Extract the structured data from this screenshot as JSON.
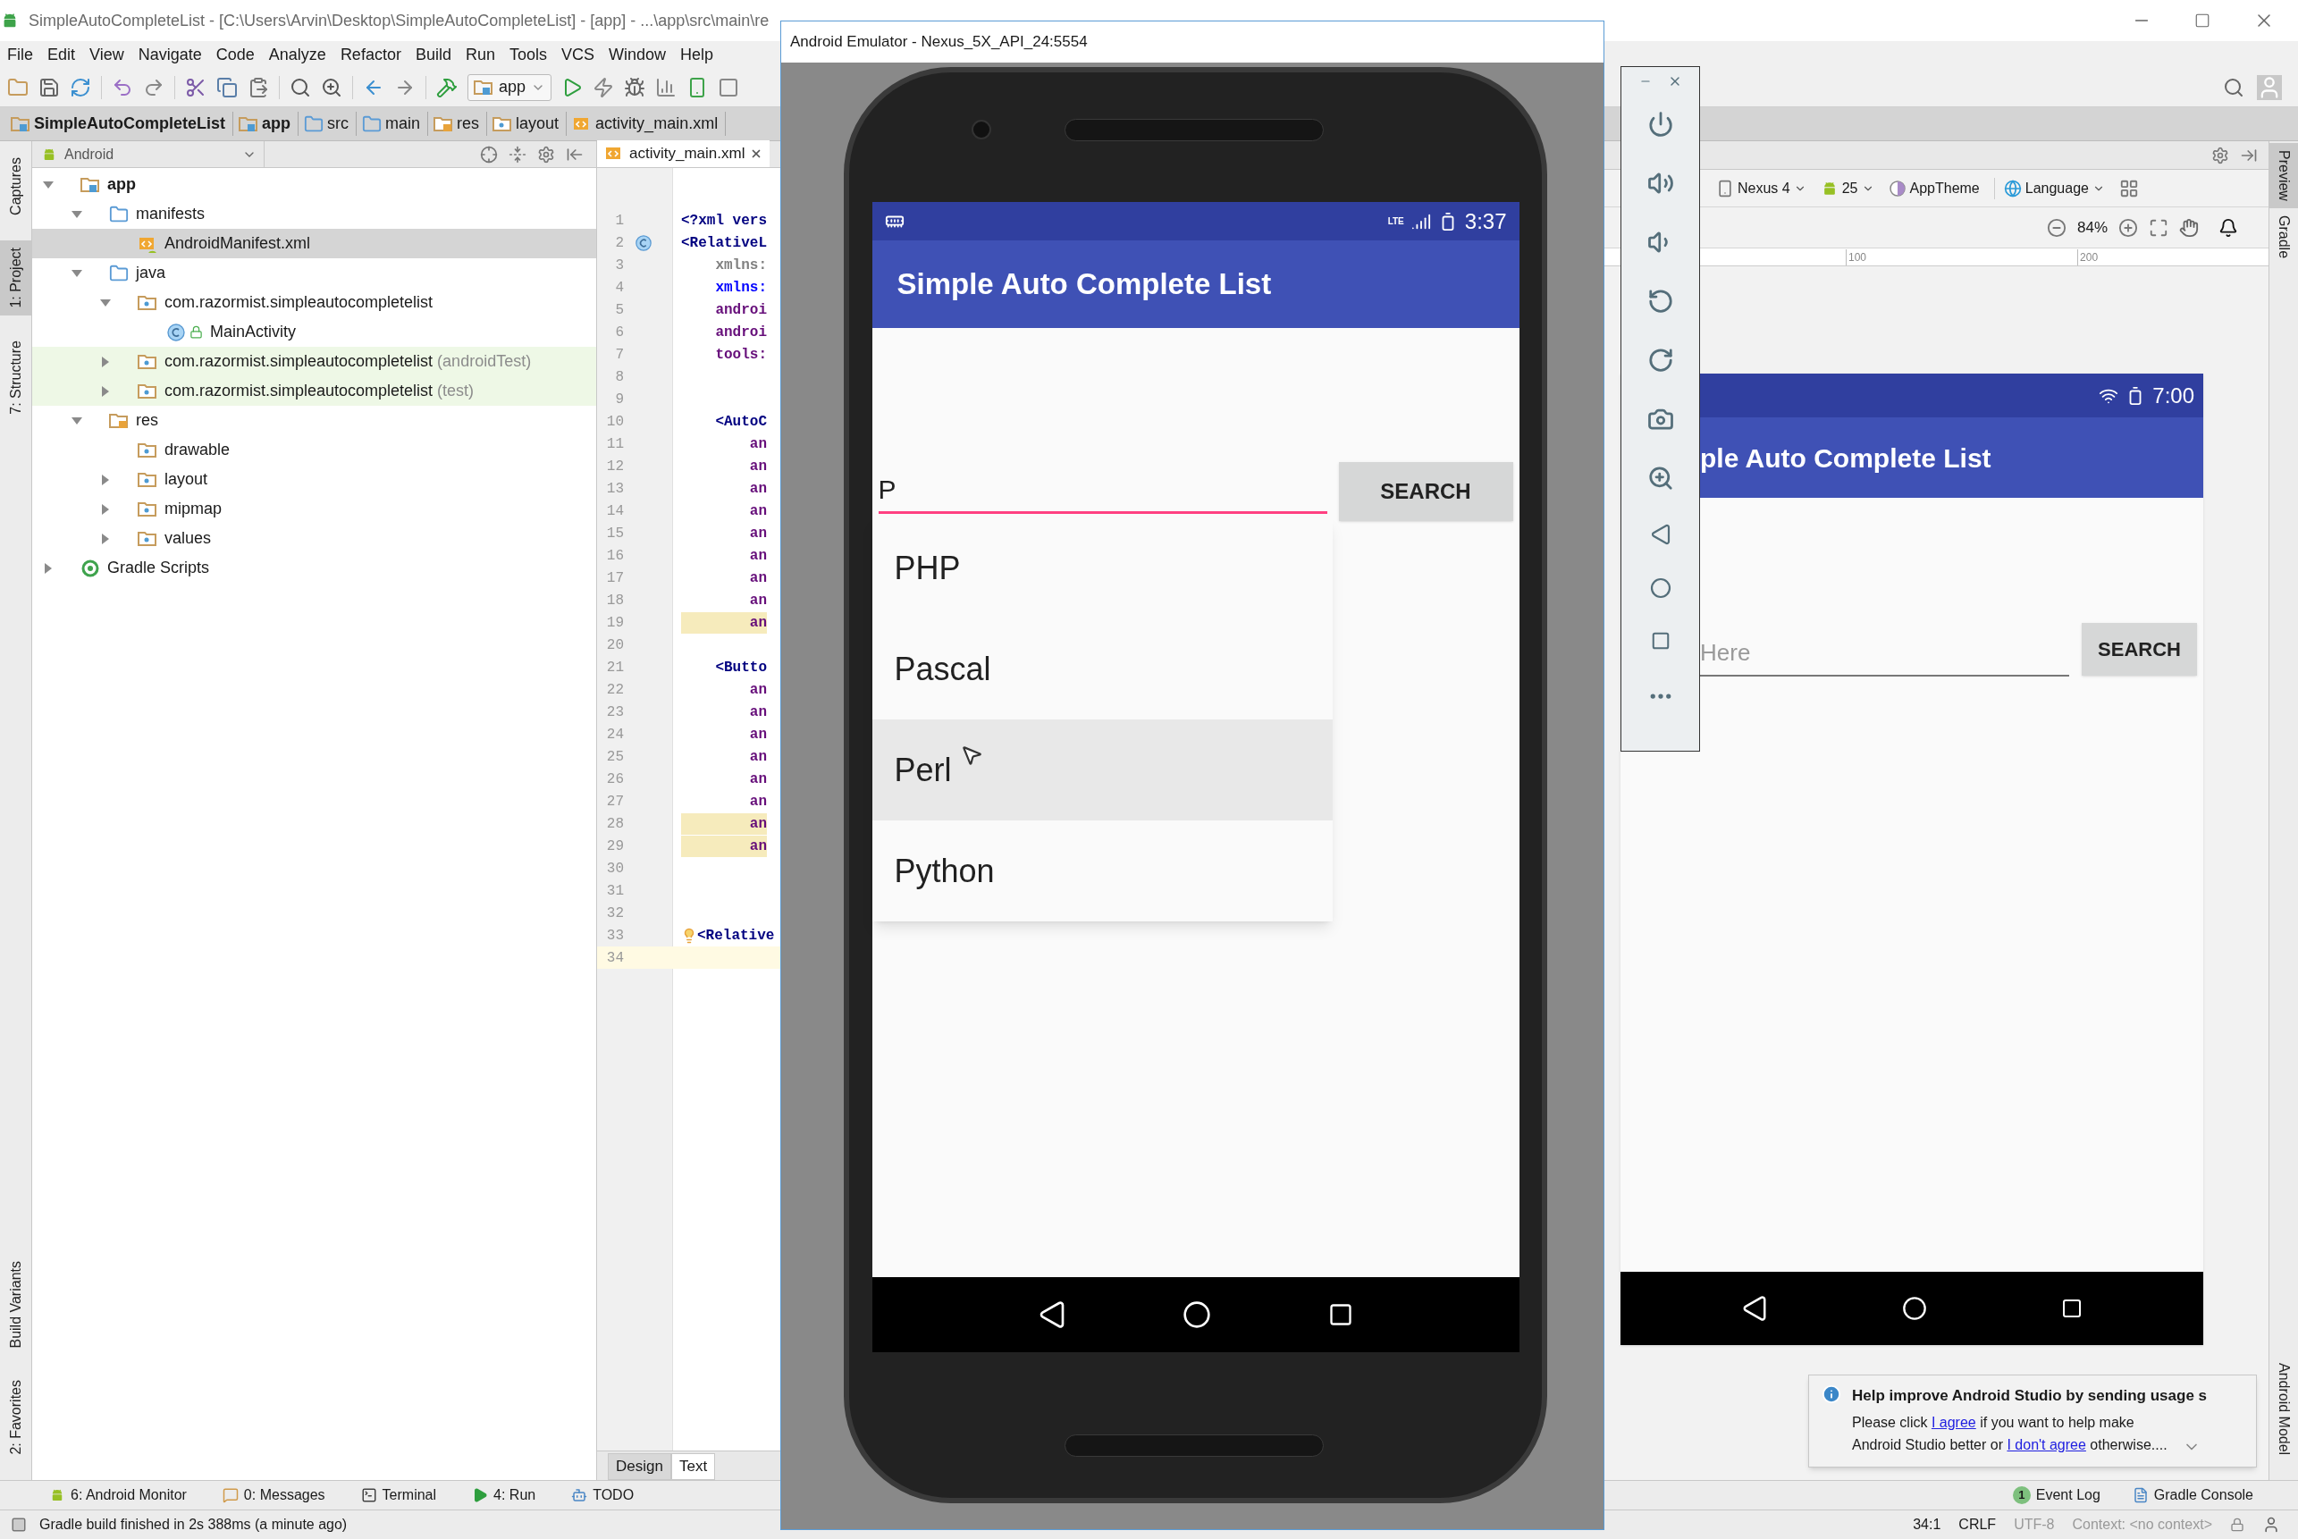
{
  "window": {
    "title": "SimpleAutoCompleteList - [C:\\Users\\Arvin\\Desktop\\SimpleAutoCompleteList] - [app] - ...\\app\\src\\main\\re"
  },
  "menu": [
    "File",
    "Edit",
    "View",
    "Navigate",
    "Code",
    "Analyze",
    "Refactor",
    "Build",
    "Run",
    "Tools",
    "VCS",
    "Window",
    "Help"
  ],
  "toolbar": {
    "run_config": "app"
  },
  "breadcrumb": [
    {
      "label": "SimpleAutoCompleteList",
      "kind": "project"
    },
    {
      "label": "app",
      "kind": "module"
    },
    {
      "label": "src",
      "kind": "folder"
    },
    {
      "label": "main",
      "kind": "folder"
    },
    {
      "label": "res",
      "kind": "res"
    },
    {
      "label": "layout",
      "kind": "layout"
    },
    {
      "label": "activity_main.xml",
      "kind": "xml"
    }
  ],
  "left_strip": [
    {
      "label": "Captures",
      "selected": false
    },
    {
      "label": "1: Project",
      "selected": true
    },
    {
      "label": "7: Structure",
      "selected": false
    },
    {
      "label": "Build Variants",
      "selected": false
    },
    {
      "label": "2: Favorites",
      "selected": false
    }
  ],
  "project": {
    "view": "Android",
    "tree": [
      {
        "label": "app",
        "kind": "module",
        "selected": false,
        "test": false,
        "expanded": true,
        "children": [
          {
            "label": "manifests",
            "kind": "folder",
            "selected": false,
            "test": false,
            "expanded": true,
            "children": [
              {
                "label": "AndroidManifest.xml",
                "kind": "manifest",
                "selected": true,
                "test": false
              }
            ]
          },
          {
            "label": "java",
            "kind": "folder",
            "selected": false,
            "test": false,
            "expanded": true,
            "children": [
              {
                "label": "com.razormist.simpleautocompletelist",
                "kind": "package",
                "selected": false,
                "test": false,
                "expanded": true,
                "children": [
                  {
                    "label": "MainActivity",
                    "kind": "class",
                    "selected": false,
                    "test": false
                  }
                ]
              },
              {
                "label": "com.razormist.simpleautocompletelist",
                "note": "(androidTest)",
                "kind": "package",
                "selected": false,
                "test": true,
                "expanded": false
              },
              {
                "label": "com.razormist.simpleautocompletelist",
                "note": "(test)",
                "kind": "package",
                "selected": false,
                "test": true,
                "expanded": false
              }
            ]
          },
          {
            "label": "res",
            "kind": "res",
            "selected": false,
            "test": false,
            "expanded": true,
            "children": [
              {
                "label": "drawable",
                "kind": "package",
                "selected": false,
                "test": false
              },
              {
                "label": "layout",
                "kind": "package",
                "selected": false,
                "test": false,
                "expanded": false
              },
              {
                "label": "mipmap",
                "kind": "package",
                "selected": false,
                "test": false,
                "expanded": false
              },
              {
                "label": "values",
                "kind": "package",
                "selected": false,
                "test": false,
                "expanded": false
              }
            ]
          }
        ]
      },
      {
        "label": "Gradle Scripts",
        "kind": "gradle",
        "selected": false,
        "test": false,
        "expanded": false
      }
    ]
  },
  "editor": {
    "tabs": [
      {
        "label": "activity_main.xml",
        "selected": true
      }
    ],
    "lines": [
      {
        "n": "1",
        "code": "<?xml vers",
        "kind": "decl",
        "warning": false,
        "current": false
      },
      {
        "n": "2",
        "code": "<RelativeL",
        "kind": "tag",
        "warning": false,
        "current": false,
        "gutter_icon": {
          "kind": "class"
        }
      },
      {
        "n": "3",
        "code": "    xmlns:",
        "kind": "ns_grey",
        "warning": false,
        "current": false
      },
      {
        "n": "4",
        "code": "    xmlns:",
        "kind": "ns",
        "warning": false,
        "current": false
      },
      {
        "n": "5",
        "code": "    androi",
        "kind": "attr",
        "warning": false,
        "current": false
      },
      {
        "n": "6",
        "code": "    androi",
        "kind": "attr",
        "warning": false,
        "current": false
      },
      {
        "n": "7",
        "code": "    tools:",
        "kind": "attr",
        "warning": false,
        "current": false
      },
      {
        "n": "8",
        "warning": false,
        "current": false
      },
      {
        "n": "9",
        "warning": false,
        "current": false
      },
      {
        "n": "10",
        "code": "    <AutoC",
        "kind": "tag",
        "warning": false,
        "current": false
      },
      {
        "n": "11",
        "code": "        an",
        "kind": "attr",
        "warning": false,
        "current": false
      },
      {
        "n": "12",
        "code": "        an",
        "kind": "attr",
        "warning": false,
        "current": false
      },
      {
        "n": "13",
        "code": "        an",
        "kind": "attr",
        "warning": false,
        "current": false
      },
      {
        "n": "14",
        "code": "        an",
        "kind": "attr",
        "warning": false,
        "current": false
      },
      {
        "n": "15",
        "code": "        an",
        "kind": "attr",
        "warning": false,
        "current": false
      },
      {
        "n": "16",
        "code": "        an",
        "kind": "attr",
        "warning": false,
        "current": false
      },
      {
        "n": "17",
        "code": "        an",
        "kind": "attr",
        "warning": false,
        "current": false
      },
      {
        "n": "18",
        "code": "        an",
        "kind": "attr",
        "warning": false,
        "current": false
      },
      {
        "n": "19",
        "code": "        an",
        "kind": "attr",
        "warning": true,
        "current": false
      },
      {
        "n": "20",
        "warning": false,
        "current": false
      },
      {
        "n": "21",
        "code": "    <Butto",
        "kind": "tag",
        "warning": false,
        "current": false
      },
      {
        "n": "22",
        "code": "        an",
        "kind": "attr",
        "warning": false,
        "current": false
      },
      {
        "n": "23",
        "code": "        an",
        "kind": "attr",
        "warning": false,
        "current": false
      },
      {
        "n": "24",
        "code": "        an",
        "kind": "attr",
        "warning": false,
        "current": false
      },
      {
        "n": "25",
        "code": "        an",
        "kind": "attr",
        "warning": false,
        "current": false
      },
      {
        "n": "26",
        "code": "        an",
        "kind": "attr",
        "warning": false,
        "current": false
      },
      {
        "n": "27",
        "code": "        an",
        "kind": "attr",
        "warning": false,
        "current": false
      },
      {
        "n": "28",
        "code": "        an",
        "kind": "attr",
        "warning": true,
        "current": false
      },
      {
        "n": "29",
        "code": "        an",
        "kind": "attr",
        "warning": true,
        "current": false
      },
      {
        "n": "30",
        "warning": false,
        "current": false
      },
      {
        "n": "31",
        "warning": false,
        "current": false
      },
      {
        "n": "32",
        "warning": false,
        "current": false
      },
      {
        "n": "33",
        "code": "<Relative",
        "kind": "tag",
        "warning": false,
        "current": false,
        "inline_icon": {
          "kind": "bulb"
        }
      },
      {
        "n": "34",
        "warning": false,
        "current": true
      }
    ],
    "mode_tabs": [
      {
        "label": "Design",
        "selected": false
      },
      {
        "label": "Text",
        "selected": true
      }
    ]
  },
  "emulator": {
    "title": "Android Emulator - Nexus_5X_API_24:5554",
    "network": "LTE",
    "time": "3:37",
    "app_title": "Simple Auto Complete List",
    "input_value": "P",
    "button": "SEARCH",
    "suggestions": [
      {
        "label": "PHP",
        "selected": false
      },
      {
        "label": "Pascal",
        "selected": false
      },
      {
        "label": "Perl",
        "selected": true
      },
      {
        "label": "Python",
        "selected": false
      }
    ],
    "controls": [
      {
        "kind": "power"
      },
      {
        "kind": "volume_up"
      },
      {
        "kind": "volume_down"
      },
      {
        "kind": "rotate_left"
      },
      {
        "kind": "rotate_right"
      },
      {
        "kind": "screenshot"
      },
      {
        "kind": "zoom"
      },
      {
        "kind": "back"
      },
      {
        "kind": "home"
      },
      {
        "kind": "overview"
      },
      {
        "kind": "more"
      }
    ]
  },
  "design": {
    "device": "Nexus 4",
    "api": "25",
    "theme": "AppTheme",
    "language": "Language",
    "zoom": "84%",
    "ruler": [
      "100",
      "200"
    ],
    "preview": {
      "time": "7:00",
      "app_title": "ple Auto Complete List",
      "hint": "Here",
      "button": "SEARCH"
    }
  },
  "right_strip": [
    {
      "label": "Preview",
      "selected": true
    },
    {
      "label": "Gradle",
      "selected": false
    },
    {
      "label": "Android Model",
      "selected": false
    }
  ],
  "bottom_tools": [
    {
      "label": "6: Android Monitor",
      "kind": "android"
    },
    {
      "label": "0: Messages",
      "kind": "messages"
    },
    {
      "label": "Terminal",
      "kind": "terminal"
    },
    {
      "label": "4: Run",
      "kind": "run"
    },
    {
      "label": "TODO",
      "kind": "todo"
    }
  ],
  "bottom_tools_right": [
    {
      "label": "Event Log",
      "badge": "1",
      "kind": "event"
    },
    {
      "label": "Gradle Console",
      "kind": "console"
    }
  ],
  "notification": {
    "title": "Help improve Android Studio by sending usage s",
    "body": [
      {
        "text": "Please click ",
        "link": false
      },
      {
        "text": "I agree",
        "link": true
      },
      {
        "text": " if you want to help make Android Studio better or ",
        "link": false
      },
      {
        "text": "I don't agree",
        "link": true
      },
      {
        "text": " otherwise....",
        "link": false
      }
    ]
  },
  "status": {
    "message": "Gradle build finished in 2s 388ms (a minute ago)",
    "position": "34:1",
    "line_separator": "CRLF",
    "encoding": "UTF-8",
    "context": "Context: <no context>"
  }
}
